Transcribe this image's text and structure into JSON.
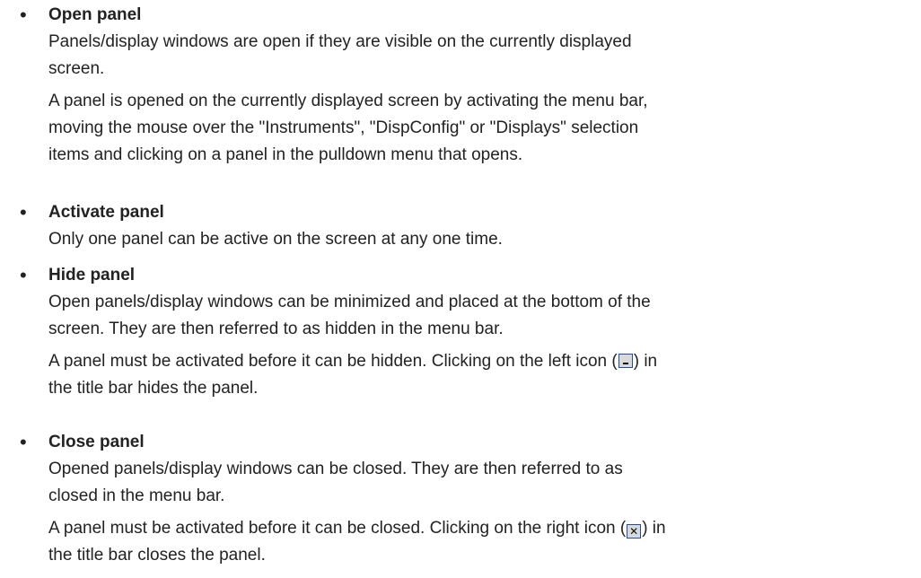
{
  "items": [
    {
      "title": "Open panel",
      "paragraphs": [
        {
          "lines": [
            "Panels/display windows are open if they are visible on the currently displayed",
            "screen."
          ]
        },
        {
          "lines": [
            "A panel is opened on the currently displayed screen by activating the menu bar,",
            "moving the mouse over the \"Instruments\", \"DispConfig\" or \"Displays\" selection",
            "items and clicking on a panel in the pulldown menu that opens."
          ]
        }
      ]
    },
    {
      "title": "Activate panel",
      "paragraphs": [
        {
          "lines": [
            "Only one panel can be active on the screen at any one time."
          ]
        }
      ]
    },
    {
      "title": "Hide panel",
      "paragraphs": [
        {
          "lines": [
            "Open panels/display windows can be minimized and placed at the bottom of the",
            "screen. They are then referred to as hidden in the menu bar."
          ]
        },
        {
          "lines": [
            "A panel must be activated before it can be hidden. Clicking on the left icon (",
            "the title bar hides the panel."
          ],
          "icon_after_line_1": {
            "icon": "minimize-icon",
            "suffix": ") in"
          }
        }
      ]
    },
    {
      "title": "Close panel",
      "paragraphs": [
        {
          "lines": [
            "Opened panels/display windows can be closed. They are then referred to as",
            "closed in the menu bar."
          ]
        },
        {
          "lines": [
            "A panel must be activated before it can be closed. Clicking on the right icon (",
            "the title bar closes the panel."
          ],
          "icon_after_line_1": {
            "icon": "close-icon",
            "suffix": ") in",
            "glyph": "✕"
          }
        }
      ]
    }
  ],
  "bullet_glyph": "•"
}
